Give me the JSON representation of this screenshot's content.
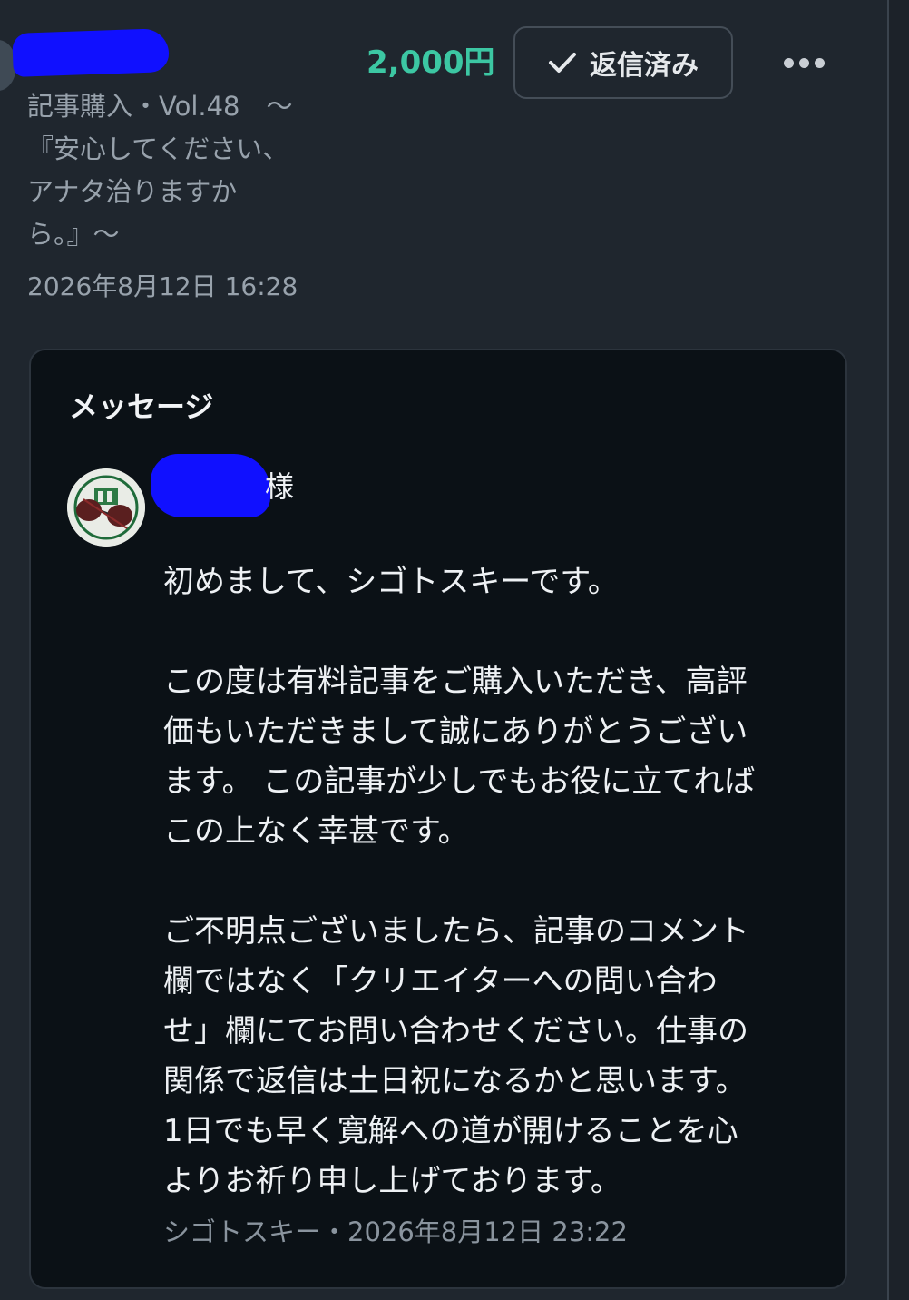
{
  "order": {
    "buyer_name_visible_fragment": "",
    "item_title": "記事購入・Vol.48　～\n『安心してください、\nアナタ治りますか\nら。』～",
    "date": "2026年8月12日 16:28",
    "price": "2,000円",
    "status_button_label": "返信済み",
    "icons": {
      "status": "check-icon",
      "menu": "more-icon"
    }
  },
  "message": {
    "heading": "メッセージ",
    "recipient_suffix": "様",
    "body": "初めまして、シゴトスキーです。\n\n この度は有料記事をご購入いただき、高評\n価もいただきまして誠にありがとうござい\nます。 この記事が少しでもお役に立てれば\nこの上なく幸甚です。\n\nご不明点ございましたら、記事のコメント\n欄ではなく「クリエイターへの問い合わ\nせ」欄にてお問い合わせください。仕事の\n関係で返信は土日祝になるかと思います。\n1日でも早く寛解への道が開けることを心\nよりお祈り申し上げております。",
    "footer": "シゴトスキー・2026年8月12日 23:22"
  },
  "colors": {
    "page_background": "#1f262e",
    "card_background": "#0b1116",
    "price_accent": "#3cc7a3",
    "muted_text": "#98a2ac",
    "redaction": "#1010ff"
  }
}
